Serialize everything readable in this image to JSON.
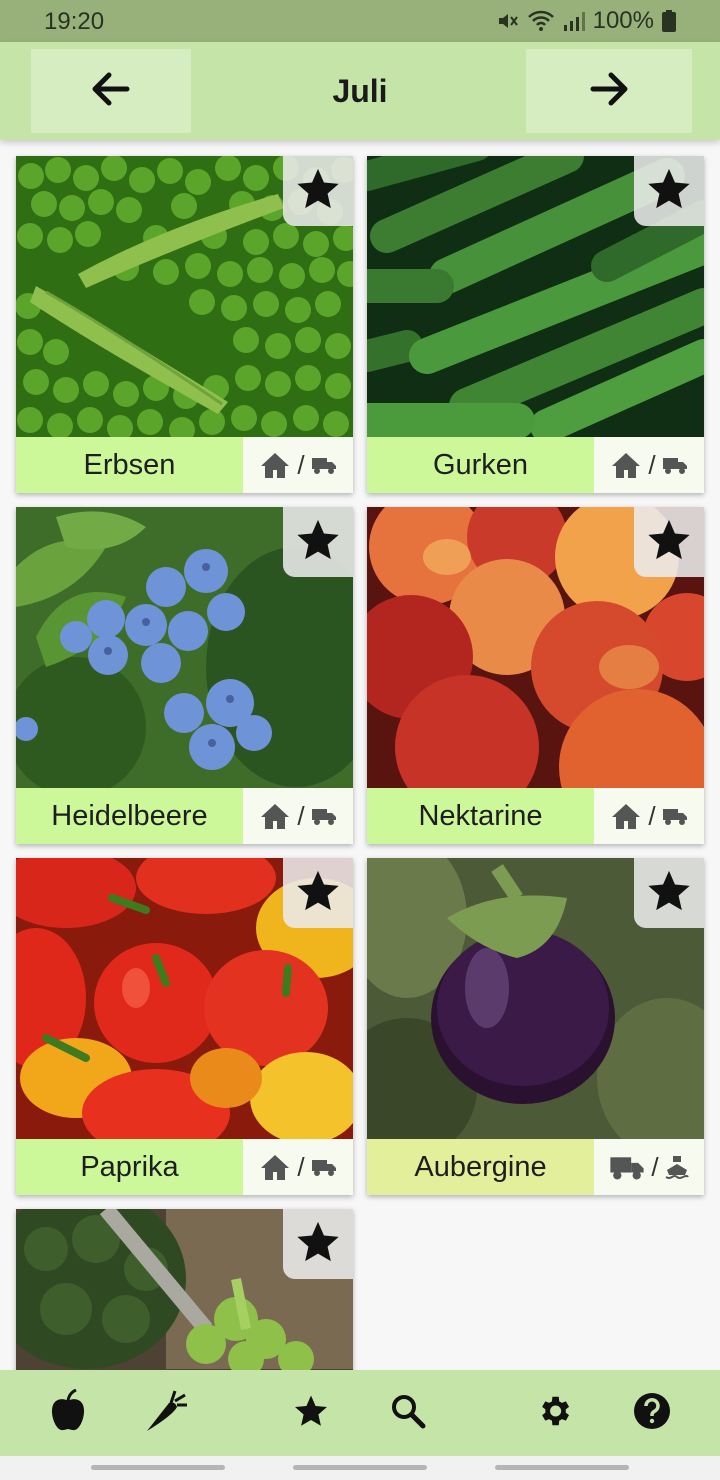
{
  "status_bar": {
    "time": "19:20",
    "battery": "100%"
  },
  "header": {
    "title": "Juli"
  },
  "produce": [
    {
      "name": "Erbsen",
      "origin_primary": "home-icon",
      "separator": "/",
      "origin_secondary": "truck-icon"
    },
    {
      "name": "Gurken",
      "origin_primary": "home-icon",
      "separator": "/",
      "origin_secondary": "truck-icon"
    },
    {
      "name": "Heidelbeere",
      "origin_primary": "home-icon",
      "separator": "/",
      "origin_secondary": "truck-icon"
    },
    {
      "name": "Nektarine",
      "origin_primary": "home-icon",
      "separator": "/",
      "origin_secondary": "truck-icon"
    },
    {
      "name": "Paprika",
      "origin_primary": "home-icon",
      "separator": "/",
      "origin_secondary": "truck-icon"
    },
    {
      "name": "Aubergine",
      "origin_primary": "truck-icon",
      "separator": "/",
      "origin_secondary": "ship-icon"
    },
    {
      "name": "",
      "origin_primary": "",
      "separator": "",
      "origin_secondary": ""
    }
  ],
  "bottom_nav": [
    "apple-icon",
    "carrot-icon",
    "star-icon",
    "search-icon",
    "gear-icon",
    "help-icon"
  ],
  "colors": {
    "header": "#c5e4a8",
    "status_bar": "#98b07a",
    "label": "#cdf89a",
    "label_alt": "#e4ef9b"
  }
}
